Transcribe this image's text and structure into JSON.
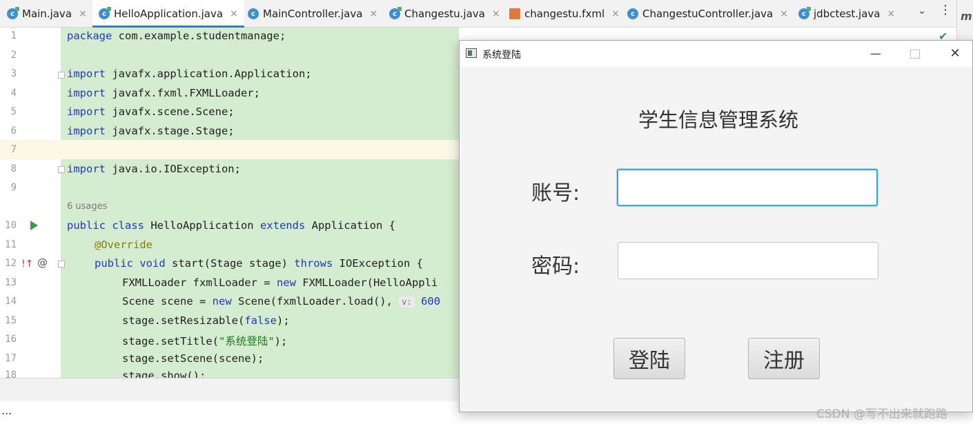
{
  "tabs": [
    {
      "label": "Main.java",
      "icon": "java-class-icon"
    },
    {
      "label": "HelloApplication.java",
      "icon": "java-class-icon",
      "active": true
    },
    {
      "label": "MainController.java",
      "icon": "java-class-icon"
    },
    {
      "label": "Changestu.java",
      "icon": "java-class-icon"
    },
    {
      "label": "changestu.fxml",
      "icon": "fxml-file-icon"
    },
    {
      "label": "ChangestuController.java",
      "icon": "java-class-icon"
    },
    {
      "label": "jdbctest.java",
      "icon": "java-class-icon"
    }
  ],
  "tab_glyph": "c",
  "close_glyph": "×",
  "line_numbers": [
    "1",
    "2",
    "3",
    "4",
    "5",
    "6",
    "7",
    "8",
    "9",
    "10",
    "11",
    "12",
    "13",
    "14",
    "15",
    "16",
    "17",
    "18"
  ],
  "code": {
    "l1_kw": "package",
    "l1_rest": " com.example.studentmanage;",
    "l3_kw": "import",
    "l3_rest": " javafx.application.Application;",
    "l4_kw": "import",
    "l4_rest": " javafx.fxml.FXMLLoader;",
    "l5_kw": "import",
    "l5_rest": " javafx.scene.Scene;",
    "l6_kw": "import",
    "l6_rest": " javafx.stage.Stage;",
    "l8_kw": "import",
    "l8_rest": " java.io.IOException;",
    "usages": "6 usages",
    "l10_kw1": "public class",
    "l10_name": " HelloApplication ",
    "l10_kw2": "extends",
    "l10_rest": " Application {",
    "l11_ann": "@Override",
    "l12_kw": "public void",
    "l12_mid": " start(Stage stage) ",
    "l12_kw2": "throws",
    "l12_rest": " IOException {",
    "l13_a": "FXMLLoader fxmlLoader = ",
    "l13_kw": "new",
    "l13_b": " FXMLLoader(HelloAppli",
    "l14_a": "Scene scene = ",
    "l14_kw": "new",
    "l14_b": " Scene(fxmlLoader.load(), ",
    "l14_hint": "v:",
    "l14_num": " 600",
    "l15_a": "stage.setResizable(",
    "l15_kw": "false",
    "l15_b": ");",
    "l16_a": "stage.setTitle(",
    "l16_str": "\"系统登陆\"",
    "l16_b": ");",
    "l17": "stage.setScene(scene);",
    "l18": "stage.show();"
  },
  "gutter_icons": {
    "override": "!↑",
    "at": "@"
  },
  "check_mark": "✔",
  "right_strip_label": "m",
  "ellipsis": "...",
  "dialog": {
    "title": "系统登陆",
    "minimize": "—",
    "maximize": "□",
    "close": "✕",
    "heading": "学生信息管理系统",
    "account_label": "账号:",
    "password_label": "密码:",
    "account_value": "",
    "password_value": "",
    "login_button": "登陆",
    "register_button": "注册"
  },
  "watermark": "CSDN @写不出来就跑路",
  "colors": {
    "accent": "#3874d8",
    "code_bg": "#d5ecd0",
    "focus_border": "#39a7e0",
    "keyword": "#1d39c4"
  }
}
